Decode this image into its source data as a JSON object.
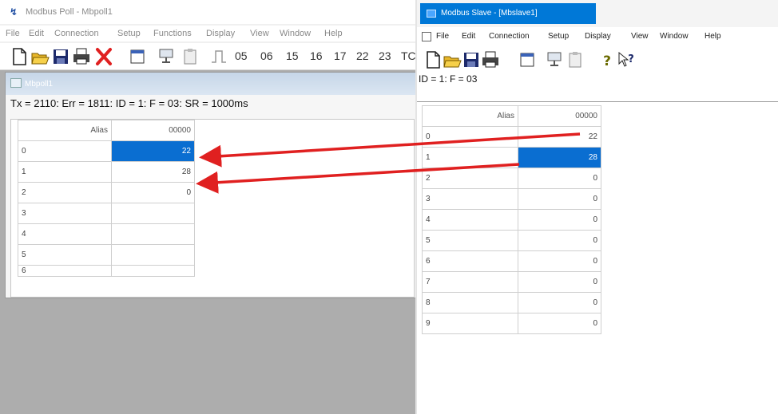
{
  "poll": {
    "title": "Modbus Poll - Mbpoll1",
    "menu": [
      "File",
      "Edit",
      "Connection",
      "Setup",
      "Functions",
      "Display",
      "View",
      "Window",
      "Help"
    ],
    "function_codes": [
      "05",
      "06",
      "15",
      "16",
      "17",
      "22",
      "23",
      "TC"
    ],
    "child_title": "Mbpoll1",
    "status": "Tx = 2110: Err = 1811: ID = 1: F = 03: SR = 1000ms",
    "table": {
      "alias_header": "Alias",
      "address_header": "00000",
      "rows": [
        {
          "index": "0",
          "value": "22"
        },
        {
          "index": "1",
          "value": "28"
        },
        {
          "index": "2",
          "value": "0"
        },
        {
          "index": "3",
          "value": ""
        },
        {
          "index": "4",
          "value": ""
        },
        {
          "index": "5",
          "value": ""
        },
        {
          "index": "6",
          "value": ""
        }
      ]
    }
  },
  "slave": {
    "title": "Modbus Slave - [Mbslave1]",
    "menu": [
      "File",
      "Edit",
      "Connection",
      "Setup",
      "Display",
      "View",
      "Window",
      "Help"
    ],
    "id_line": "ID = 1: F = 03",
    "table": {
      "alias_header": "Alias",
      "address_header": "00000",
      "rows": [
        {
          "index": "0",
          "value": "22"
        },
        {
          "index": "1",
          "value": "28"
        },
        {
          "index": "2",
          "value": "0"
        },
        {
          "index": "3",
          "value": "0"
        },
        {
          "index": "4",
          "value": "0"
        },
        {
          "index": "5",
          "value": "0"
        },
        {
          "index": "6",
          "value": "0"
        },
        {
          "index": "7",
          "value": "0"
        },
        {
          "index": "8",
          "value": "0"
        },
        {
          "index": "9",
          "value": "0"
        }
      ]
    }
  },
  "colors": {
    "selection": "#0a6ed1",
    "arrow": "#e02020",
    "active_titlebar": "#0078d7"
  },
  "icons": {
    "poll_toolbar": [
      "new-file-icon",
      "open-folder-icon",
      "save-icon",
      "print-icon",
      "delete-icon",
      "window-icon",
      "connect-icon",
      "clipboard-icon",
      "pulse-icon"
    ],
    "slave_toolbar": [
      "new-file-icon",
      "open-folder-icon",
      "save-icon",
      "print-icon",
      "window-icon",
      "connect-icon",
      "clipboard-icon",
      "help-icon",
      "context-help-icon"
    ]
  }
}
